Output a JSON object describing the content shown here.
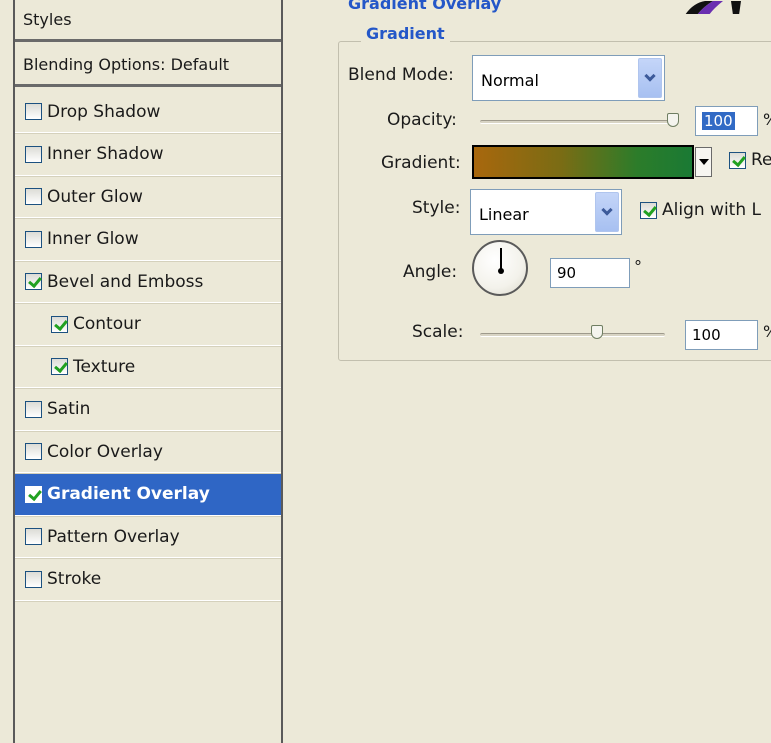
{
  "styles_panel": {
    "header": "Styles",
    "blending_options": "Blending Options: Default",
    "items": [
      {
        "label": "Drop Shadow",
        "checked": false,
        "selected": false,
        "indent": false
      },
      {
        "label": "Inner Shadow",
        "checked": false,
        "selected": false,
        "indent": false
      },
      {
        "label": "Outer Glow",
        "checked": false,
        "selected": false,
        "indent": false
      },
      {
        "label": "Inner Glow",
        "checked": false,
        "selected": false,
        "indent": false
      },
      {
        "label": "Bevel and Emboss",
        "checked": true,
        "selected": false,
        "indent": false
      },
      {
        "label": "Contour",
        "checked": true,
        "selected": false,
        "indent": true
      },
      {
        "label": "Texture",
        "checked": true,
        "selected": false,
        "indent": true
      },
      {
        "label": "Satin",
        "checked": false,
        "selected": false,
        "indent": false
      },
      {
        "label": "Color Overlay",
        "checked": false,
        "selected": false,
        "indent": false
      },
      {
        "label": "Gradient Overlay",
        "checked": true,
        "selected": true,
        "indent": false
      },
      {
        "label": "Pattern Overlay",
        "checked": false,
        "selected": false,
        "indent": false
      },
      {
        "label": "Stroke",
        "checked": false,
        "selected": false,
        "indent": false
      }
    ]
  },
  "gradient_overlay": {
    "section_title": "Gradient Overlay",
    "group_title": "Gradient",
    "blend_mode_label": "Blend Mode:",
    "blend_mode_value": "Normal",
    "opacity_label": "Opacity:",
    "opacity_value": "100",
    "opacity_unit": "%",
    "opacity_fraction": 1.0,
    "gradient_label": "Gradient:",
    "reverse_label": "Re",
    "reverse_checked": true,
    "style_label": "Style:",
    "style_value": "Linear",
    "align_label": "Align with L",
    "align_checked": true,
    "angle_label": "Angle:",
    "angle_value": "90",
    "angle_unit": "°",
    "scale_label": "Scale:",
    "scale_value": "100",
    "scale_unit": "%",
    "gradient_colors": [
      "#A8670D",
      "#1A7A34"
    ]
  },
  "colors": {
    "selection": "#2F66C5",
    "title_blue": "#2457C8",
    "background": "#ECE9D8"
  }
}
